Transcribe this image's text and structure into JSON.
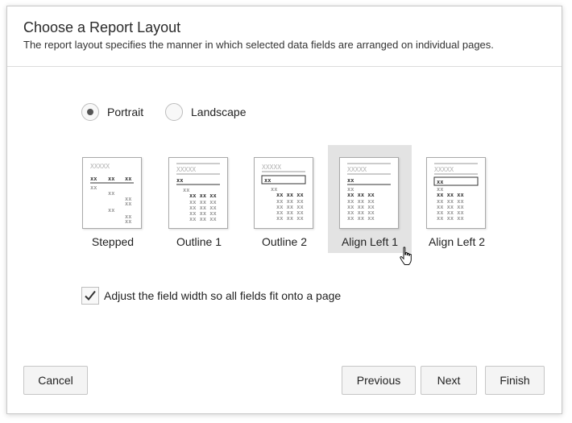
{
  "dialog": {
    "title": "Choose a Report Layout",
    "subtitle": "The report layout specifies the manner in which selected data fields are arranged on individual pages."
  },
  "orientation": {
    "selected": "Portrait",
    "options": [
      {
        "label": "Portrait",
        "selected": true
      },
      {
        "label": "Landscape",
        "selected": false
      }
    ]
  },
  "layouts": {
    "selected": "Align Left 1",
    "items": [
      {
        "label": "Stepped",
        "selected": false
      },
      {
        "label": "Outline 1",
        "selected": false
      },
      {
        "label": "Outline 2",
        "selected": false
      },
      {
        "label": "Align Left 1",
        "selected": true
      },
      {
        "label": "Align Left 2",
        "selected": false
      }
    ]
  },
  "adjust_field_width": {
    "label": "Adjust the field width so all fields fit onto a page",
    "checked": true
  },
  "buttons": {
    "cancel": "Cancel",
    "previous": "Previous",
    "next": "Next",
    "finish": "Finish"
  },
  "colors": {
    "selected_tile": "#e3e3e3",
    "border": "#c6c6c6",
    "text": "#222222"
  }
}
